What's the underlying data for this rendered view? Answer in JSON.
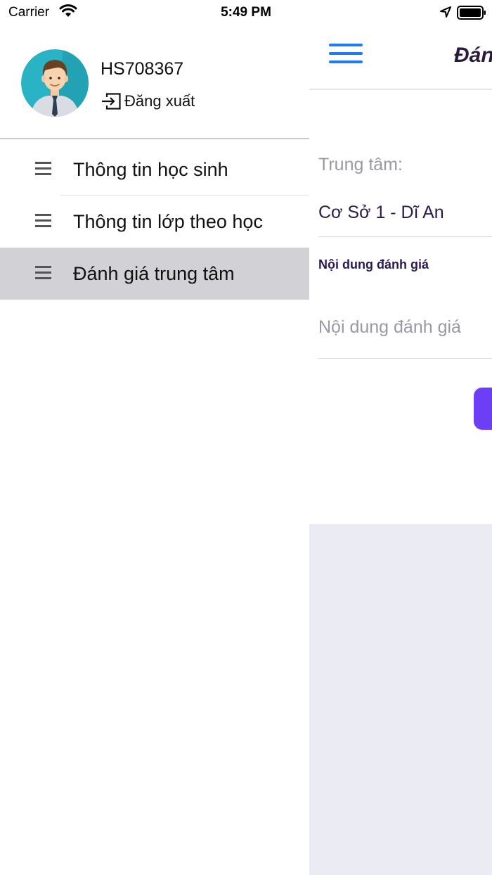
{
  "status_bar": {
    "carrier": "Carrier",
    "time": "5:49 PM"
  },
  "drawer": {
    "username": "HS708367",
    "logout_label": "Đăng xuất",
    "menu_items": [
      {
        "label": "Thông tin học sinh",
        "active": false
      },
      {
        "label": "Thông tin lớp theo học",
        "active": false
      },
      {
        "label": "Đánh giá trung tâm",
        "active": true
      }
    ]
  },
  "main": {
    "title": "Đánh giá",
    "center_label": "Trung tâm:",
    "center_value": "Cơ Sở 1 - Dĩ An",
    "content_label": "Nội dung đánh giá",
    "content_placeholder": "Nội dung đánh giá"
  },
  "colors": {
    "accent_blue": "#1e7cf2",
    "submit_purple": "#6c3ef5",
    "active_item_bg": "#d1d1d6",
    "text_dark_purple": "#2b1a52"
  },
  "icons": {
    "menu_button": "hamburger-icon",
    "menu_items": "list-icon",
    "logout": "logout-icon",
    "status_right": [
      "location-arrow-icon",
      "battery-icon"
    ],
    "status_left": "wifi-icon"
  }
}
